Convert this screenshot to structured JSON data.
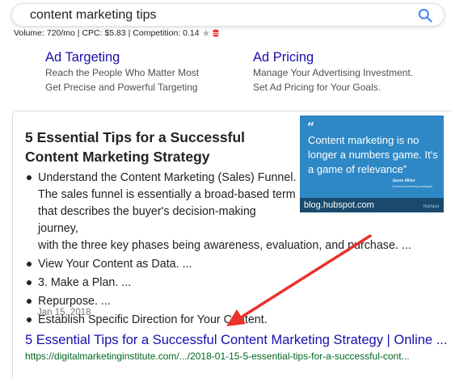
{
  "search": {
    "query": "content marketing tips"
  },
  "keyword_stats": {
    "text": "Volume: 720/mo | CPC: $5.83 | Competition: 0.14"
  },
  "sitelinks": [
    {
      "title": "Ad Targeting",
      "line1": "Reach the People Who Matter Most",
      "line2": "Get Precise and Powerful Targeting"
    },
    {
      "title": "Ad Pricing",
      "line1": "Manage Your Advertising Investment.",
      "line2": "Set Ad Pricing for Your Goals."
    }
  ],
  "featured_snippet": {
    "title": "5 Essential Tips for a Successful Content Marketing Strategy",
    "items": [
      {
        "title": "Understand the Content Marketing (Sales) Funnel.",
        "desc_part1": "The sales funnel is essentially a broad-based term that describes the buyer's decision-making journey,",
        "desc_part2": "with the three key phases being awareness, evaluation, and purchase. ..."
      },
      {
        "title": "View Your Content as Data. ..."
      },
      {
        "title": "3. Make a Plan. ..."
      },
      {
        "title": "Repurpose. ..."
      },
      {
        "title": "Establish Specific Direction for Your Content."
      }
    ],
    "date": "Jan 15, 2018",
    "image": {
      "quote_mark": "“",
      "quote": "Content marketing is no longer a numbers game. It's a game of relevance”",
      "author": "Jason Miller",
      "role": "Content marketing strategist",
      "caption": "blog.hubspot.com",
      "brand": "HubSpot"
    },
    "result_title": "5 Essential Tips for a Successful Content Marketing Strategy | Online ...",
    "result_url": "https://digitalmarketinginstitute.com/.../2018-01-15-5-essential-tips-for-a-successful-cont..."
  },
  "colors": {
    "link": "#1a0dab",
    "url": "#006621",
    "image_bg": "#2e88c6",
    "arrow": "#e8322a"
  }
}
